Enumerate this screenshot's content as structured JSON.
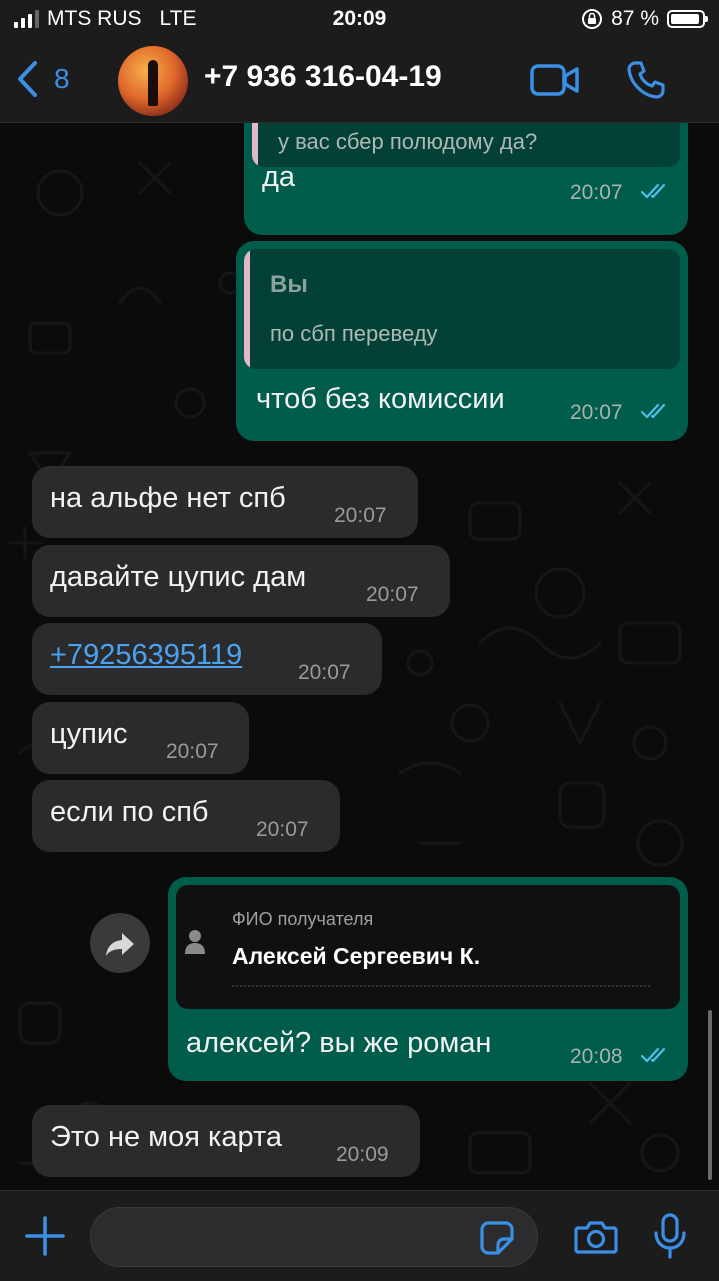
{
  "status": {
    "carrier": "MTS RUS",
    "network": "LTE",
    "time": "20:09",
    "battery": "87 %"
  },
  "header": {
    "back_count": "8",
    "contact": "+7 936 316-04-19"
  },
  "messages": {
    "m1": {
      "quote_text": "у вас сбер полюдому да?",
      "text": "да",
      "time": "20:07"
    },
    "m2": {
      "quote_author": "Вы",
      "quote_text": "по сбп переведу",
      "text": "чтоб без комиссии",
      "time": "20:07"
    },
    "m3": {
      "text": "на альфе нет спб",
      "time": "20:07"
    },
    "m4": {
      "text": "давайте цупис дам",
      "time": "20:07"
    },
    "m5": {
      "text": "+79256395119",
      "time": "20:07"
    },
    "m6": {
      "text": "цупис",
      "time": "20:07"
    },
    "m7": {
      "text": "если по спб",
      "time": "20:07"
    },
    "m8": {
      "card_label": "ФИО получателя",
      "card_value": "Алексей Сергеевич К.",
      "text": "алексей? вы же роман",
      "time": "20:08"
    },
    "m9": {
      "text": "Это не моя карта",
      "time": "20:09"
    }
  },
  "input": {
    "value": "",
    "placeholder": ""
  },
  "colors": {
    "accent": "#3b8fe6",
    "outgoing": "#005c4b",
    "incoming": "#2b2b2d",
    "read_ticks": "#53bdeb"
  },
  "icons": [
    "back-chevron-icon",
    "video-call-icon",
    "phone-icon",
    "plus-icon",
    "sticker-icon",
    "camera-icon",
    "mic-icon",
    "forward-icon",
    "person-icon",
    "read-ticks-icon"
  ]
}
